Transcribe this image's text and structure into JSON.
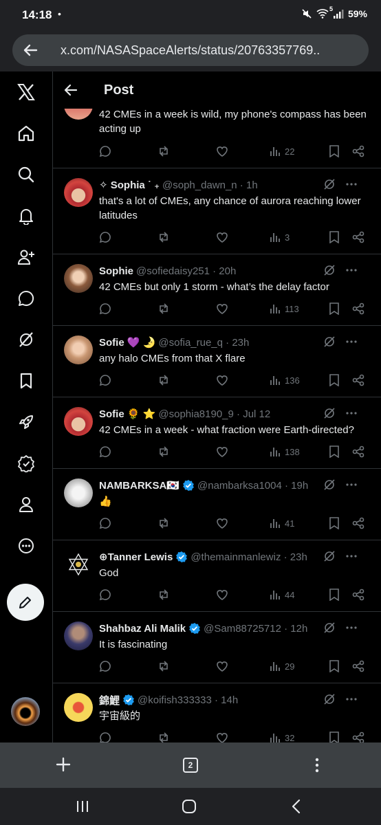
{
  "status": {
    "time": "14:18",
    "dot": "•",
    "battery": "59%",
    "wifi_badge": "5"
  },
  "browser": {
    "url": "x.com/NASASpaceAlerts/status/20763357769..",
    "tab_count": "2"
  },
  "header": {
    "title": "Post"
  },
  "tweets": [
    {
      "name": "",
      "handle": "",
      "time": "",
      "text": "42 CMEs in a week is wild, my phone's compass has been acting up",
      "views": "22"
    },
    {
      "name": "✧ Sophia ˙ ₊",
      "handle": "@soph_dawn_n · 1h",
      "text": "that's a lot of CMEs, any chance of aurora reaching lower latitudes",
      "views": "3"
    },
    {
      "name": "Sophie",
      "handle": "@sofiedaisy251 · 20h",
      "text": "42 CMEs but only 1 storm - what’s the delay factor",
      "views": "113"
    },
    {
      "name": "Sofie 💜 🌛",
      "handle": "@sofia_rue_q · 23h",
      "text": "any halo CMEs from that X flare",
      "views": "136"
    },
    {
      "name": "Sofie 🌻 ⭐",
      "handle": "@sophia8190_9 · Jul 12",
      "text": "42 CMEs in a week - what fraction were Earth-directed?",
      "views": "138"
    },
    {
      "name": "NAMBARKSA🇰🇷",
      "handle": "@nambarksa1004 · 19h",
      "text": "👍",
      "views": "41"
    },
    {
      "name": "⊕Tanner Lewis",
      "handle": "@themainmanlewiz · 23h",
      "text": "God",
      "views": "44"
    },
    {
      "name": "Shahbaz Ali Malik",
      "handle": "@Sam88725712 · 12h",
      "text": "It is fascinating",
      "views": "29"
    },
    {
      "name": "錦鯉",
      "handle": "@koifish333333 · 14h",
      "text": "宇宙級的",
      "views": "32"
    }
  ],
  "colors": {
    "verified": "#1d9bf0",
    "muted": "#71767b",
    "divider": "#2f3336"
  }
}
